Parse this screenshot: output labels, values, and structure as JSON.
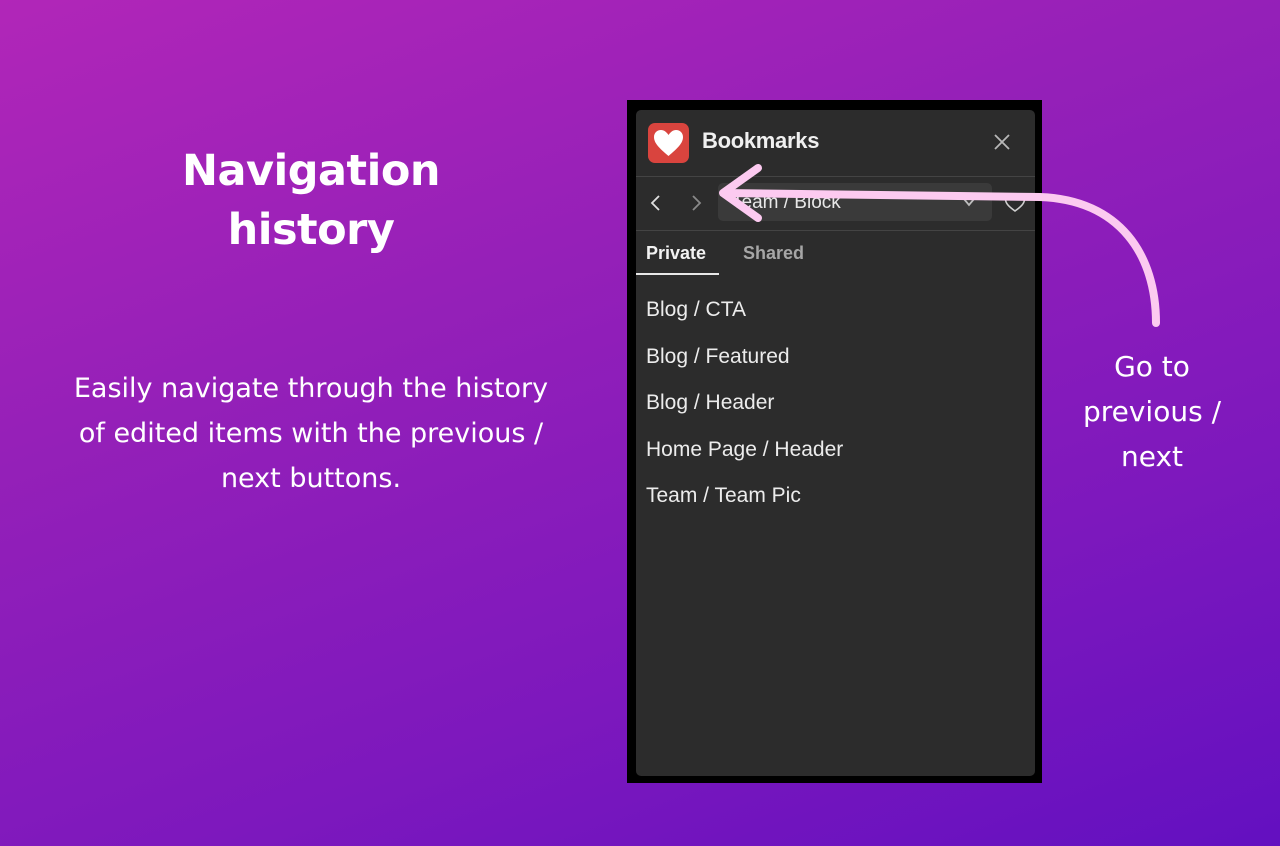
{
  "intro": {
    "title": "Navigation history",
    "description": "Easily navigate through the history of edited items with the previous / next buttons."
  },
  "panel": {
    "app_title": "Bookmarks",
    "logo_icon": "heart-icon",
    "history_select_value": "Team / Block",
    "tabs": [
      {
        "label": "Private",
        "active": true
      },
      {
        "label": "Shared",
        "active": false
      }
    ],
    "items": [
      {
        "label": "Blog / CTA"
      },
      {
        "label": "Blog / Featured"
      },
      {
        "label": "Blog / Header"
      },
      {
        "label": "Home Page / Header"
      },
      {
        "label": "Team / Team Pic"
      }
    ]
  },
  "annotation": {
    "text": "Go to previous / next"
  },
  "colors": {
    "panel_bg": "#2c2c2c",
    "logo_red": "#d9443e",
    "arrow_pink": "#fccaf0"
  }
}
